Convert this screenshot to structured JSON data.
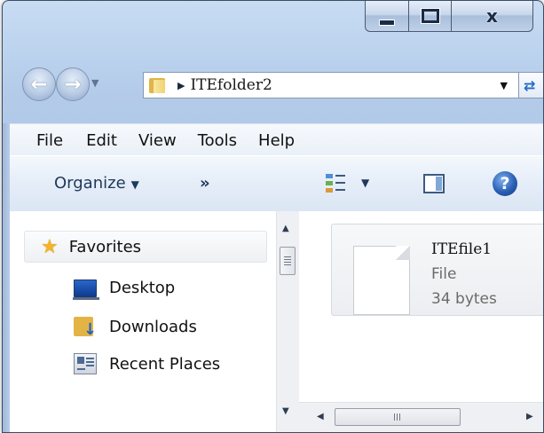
{
  "window": {
    "minimize_icon": "minimize-icon",
    "maximize_icon": "maximize-icon",
    "close_glyph": "x"
  },
  "navigation": {
    "back_icon": "back-arrow-icon",
    "forward_icon": "forward-arrow-icon",
    "back_glyph": "←",
    "forward_glyph": "→",
    "address": {
      "separator": "▶",
      "current_folder": "ITEfolder2",
      "dropdown": "▼"
    },
    "refresh_glyph": "⇄"
  },
  "menu": {
    "items": [
      "File",
      "Edit",
      "View",
      "Tools",
      "Help"
    ]
  },
  "commands": {
    "organize_label": "Organize",
    "organize_dropdown": "▼",
    "more_label": "»",
    "views_dropdown": "▼",
    "help_glyph": "?"
  },
  "nav_pane": {
    "favorites_label": "Favorites",
    "items": [
      {
        "label": "Desktop",
        "icon": "desktop-icon"
      },
      {
        "label": "Downloads",
        "icon": "downloads-icon"
      },
      {
        "label": "Recent Places",
        "icon": "recent-places-icon"
      }
    ]
  },
  "files": [
    {
      "name": "ITEfile1",
      "type": "File",
      "size": "34 bytes",
      "icon": "document-icon"
    }
  ],
  "scrollbars": {
    "up": "▲",
    "down": "▼",
    "left": "◀",
    "right": "▶"
  },
  "colors": {
    "frame": "#b3cbe9",
    "command_bar": "#e5edf8",
    "favorites_star": "#f4b42a",
    "help": "#2a5fb5"
  }
}
